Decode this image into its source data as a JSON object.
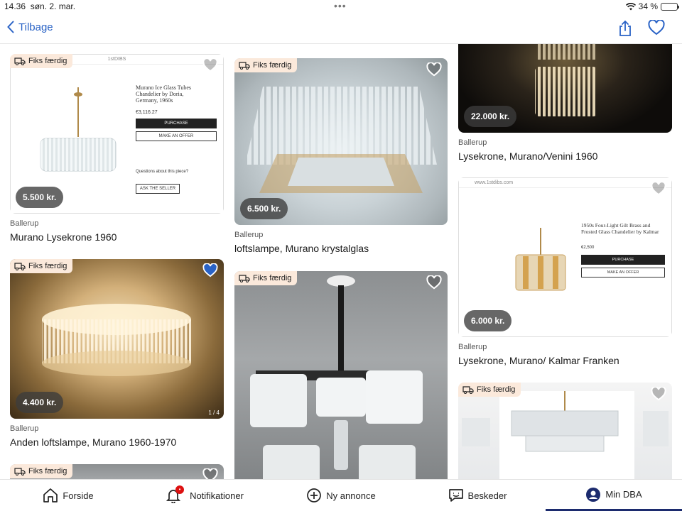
{
  "status": {
    "time": "14.36",
    "date": "søn. 2. mar.",
    "battery": "34 %",
    "battery_level": 0.34
  },
  "nav": {
    "back_label": "Tilbage"
  },
  "badge_label": "Fiks færdig",
  "cards": [
    {
      "price": "5.500 kr.",
      "location": "Ballerup",
      "title": "Murano Lysekrone 1960",
      "shot": {
        "site": "1stDIBS",
        "product": "Murano Ice Glass Tubes Chandelier by Doria, Germany, 1960s",
        "amount": "€3,116.27",
        "purchase": "PURCHASE",
        "offer": "MAKE AN OFFER",
        "ask": "ASK THE SELLER",
        "question": "Questions about this piece?"
      }
    },
    {
      "price": "6.500 kr.",
      "location": "Ballerup",
      "title": "loftslampe, Murano krystalglas"
    },
    {
      "price": "22.000 kr.",
      "location": "Ballerup",
      "title": "Lysekrone, Murano/Venini 1960"
    },
    {
      "price": "4.400 kr.",
      "location": "Ballerup",
      "title": "Anden loftslampe, Murano 1960-1970",
      "counter": "1 / 4"
    },
    {
      "price": "6.000 kr.",
      "location": "Ballerup",
      "title": "Lysekrone, Murano/ Kalmar Franken",
      "shot": {
        "url": "www.1stdibs.com",
        "product": "1950s Four-Light Gilt Brass and Frosted Glass Chandelier by Kalmar",
        "amount": "€2,500",
        "purchase": "PURCHASE",
        "offer": "MAKE AN OFFER"
      }
    }
  ],
  "tabs": [
    {
      "label": "Forside",
      "icon": "home-icon"
    },
    {
      "label": "Notifikationer",
      "icon": "bell-icon"
    },
    {
      "label": "Ny annonce",
      "icon": "plus-circle-icon"
    },
    {
      "label": "Beskeder",
      "icon": "chat-icon"
    },
    {
      "label": "Min DBA",
      "icon": "avatar-icon",
      "active": true
    }
  ]
}
